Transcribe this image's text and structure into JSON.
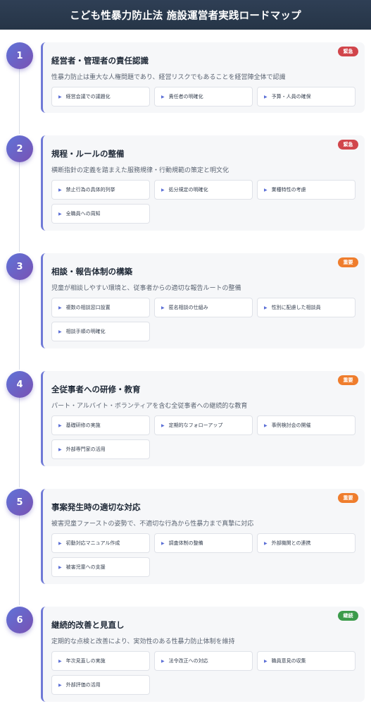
{
  "title": "こども性暴力防止法 施設運営者実践ロードマップ",
  "steps": [
    {
      "number": "1",
      "title": "経営者・管理者の責任認識",
      "description": "性暴力防止は重大な人権問題であり、経営リスクでもあることを経営陣全体で認識",
      "badge": "緊急",
      "badge_color": "#d1454b",
      "items": [
        "経営会議での議題化",
        "責任者の明確化",
        "予算・人員の確保"
      ]
    },
    {
      "number": "2",
      "title": "規程・ルールの整備",
      "description": "横断指針の定義を踏まえた服務規律・行動規範の策定と明文化",
      "badge": "緊急",
      "badge_color": "#d1454b",
      "items": [
        "禁止行為の具体的列挙",
        "処分規定の明確化",
        "業種特性の考慮",
        "全職員への周知"
      ]
    },
    {
      "number": "3",
      "title": "相談・報告体制の構築",
      "description": "児童が相談しやすい環境と、従事者からの適切な報告ルートの整備",
      "badge": "重要",
      "badge_color": "#ef7d2d",
      "items": [
        "複数の相談窓口設置",
        "匿名相談の仕組み",
        "性別に配慮した相談員",
        "相談手順の明確化"
      ]
    },
    {
      "number": "4",
      "title": "全従事者への研修・教育",
      "description": "パート・アルバイト・ボランティアを含む全従事者への継続的な教育",
      "badge": "重要",
      "badge_color": "#ef7d2d",
      "items": [
        "基礎研修の実施",
        "定期的なフォローアップ",
        "事例検討会の開催",
        "外部専門家の活用"
      ]
    },
    {
      "number": "5",
      "title": "事案発生時の適切な対応",
      "description": "被害児童ファーストの姿勢で、不適切な行為から性暴力まで真摯に対応",
      "badge": "重要",
      "badge_color": "#ef7d2d",
      "items": [
        "初動対応マニュアル作成",
        "調査体制の整備",
        "外部機関との連携",
        "被害児童への支援"
      ]
    },
    {
      "number": "6",
      "title": "継続的改善と見直し",
      "description": "定期的な点検と改善により、実効性のある性暴力防止体制を維持",
      "badge": "継続",
      "badge_color": "#3c9b4b",
      "items": [
        "年次見直しの実施",
        "法令改正への対応",
        "職員意見の収集",
        "外部評価の活用"
      ]
    }
  ]
}
